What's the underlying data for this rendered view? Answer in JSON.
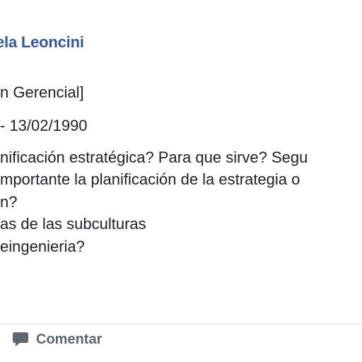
{
  "post": {
    "author": "ela Leoncini",
    "lines": [
      "n Gerencial]",
      " - 13/02/1990",
      "nificación estratégica? Para que sirve? Segu",
      "mportante la planificación de la estrategia o",
      "n?",
      "as de las subculturas",
      "eingenieria?"
    ]
  },
  "actions": {
    "comment_label": "Comentar",
    "comment_icon": "speech-bubble-icon"
  },
  "colors": {
    "author": "#365899",
    "text": "#1d2129",
    "action_text": "#606770",
    "background": "#e9ebee"
  }
}
